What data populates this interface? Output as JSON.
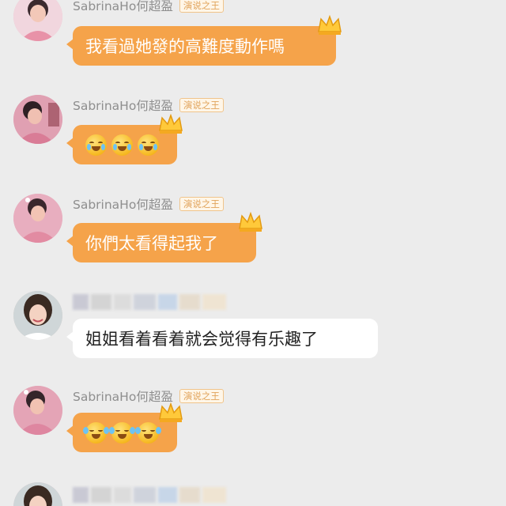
{
  "messages": [
    {
      "sender": "SabrinaHo何超盈",
      "badge": "演说之王",
      "text": "我看過她發的高難度動作嗎",
      "type": "host"
    },
    {
      "sender": "SabrinaHo何超盈",
      "badge": "演说之王",
      "emojis": [
        "crying-smile-emoji",
        "crying-smile-emoji",
        "crying-smile-emoji"
      ],
      "type": "host"
    },
    {
      "sender": "SabrinaHo何超盈",
      "badge": "演说之王",
      "text": "你們太看得起我了",
      "type": "host"
    },
    {
      "sender": "",
      "text": "姐姐看着看着就会觉得有乐趣了",
      "type": "other",
      "sender_blurred": true
    },
    {
      "sender": "SabrinaHo何超盈",
      "badge": "演说之王",
      "emojis": [
        "tears-of-joy-emoji",
        "tears-of-joy-emoji",
        "tears-of-joy-emoji"
      ],
      "type": "host"
    },
    {
      "sender": "",
      "type": "other",
      "sender_blurred": true
    }
  ],
  "colors": {
    "background": "#ececec",
    "host_bubble": "#f5a34a",
    "other_bubble": "#ffffff",
    "badge_text": "#e0a35a",
    "username": "#8e8e8e"
  }
}
